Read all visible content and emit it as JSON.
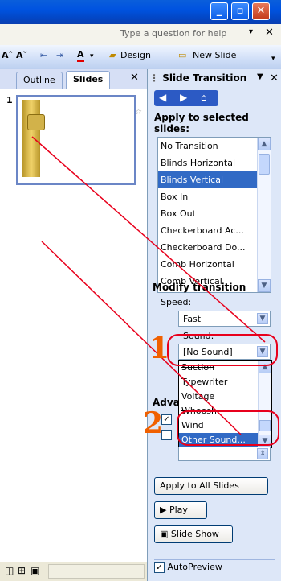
{
  "window": {
    "minimize": "_",
    "maximize": "▫",
    "close": "✕"
  },
  "menu": {
    "help_placeholder": "Type a question for help",
    "dropdown": "▾",
    "close": "✕"
  },
  "toolbar": {
    "font_grow": "Aˆ",
    "font_shrink": "Aˇ",
    "design": "Design",
    "new_slide": "New Slide"
  },
  "left_pane": {
    "tabs": [
      "Outline",
      "Slides"
    ],
    "close": "✕",
    "slide_number": "1"
  },
  "task_pane": {
    "title": "Slide Transition",
    "apply_heading": "Apply to selected slides:",
    "transitions": [
      "No Transition",
      "Blinds Horizontal",
      "Blinds Vertical",
      "Box In",
      "Box Out",
      "Checkerboard Ac...",
      "Checkerboard Do...",
      "Comb Horizontal",
      "Comb Vertical"
    ],
    "selected_transition": "Blinds Vertical",
    "modify_heading": "Modify transition",
    "speed_label": "Speed:",
    "speed_value": "Fast",
    "sound_label": "Sound:",
    "sound_value": "[No Sound]",
    "sound_options": [
      "Suction",
      "Typewriter",
      "Voltage",
      "Whoosh",
      "Wind",
      "Other Sound..."
    ],
    "sound_selected": "Other Sound...",
    "advance_heading": "Adva",
    "apply_all": "Apply to All Slides",
    "play": "Play",
    "slideshow": "Slide Show",
    "autopreview": "AutoPreview",
    "autopreview_checked": true
  },
  "annotations": {
    "one": "1",
    "two": "2"
  },
  "colors": {
    "accent": "#316ac5",
    "annotation": "#e8001c",
    "number": "#f06000"
  }
}
